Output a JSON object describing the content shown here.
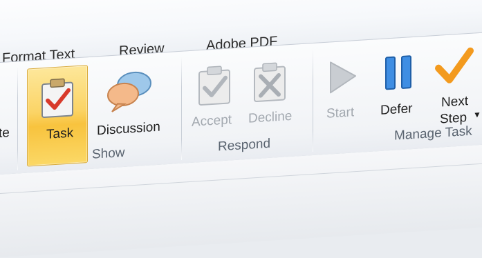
{
  "tabs": [
    "Format Text",
    "Review",
    "Adobe PDF"
  ],
  "left_partial_label": "te",
  "show_group": {
    "label": "Show",
    "task_label": "Task",
    "discussion_label": "Discussion"
  },
  "respond_group": {
    "label": "Respond",
    "accept_label": "Accept",
    "decline_label": "Decline"
  },
  "manage_group": {
    "label": "Manage Task",
    "start_label": "Start",
    "defer_label": "Defer",
    "next_step_line1": "Next",
    "next_step_line2": "Step"
  },
  "icons": {
    "task": "clipboard-check-icon",
    "discussion": "speech-bubbles-icon",
    "accept": "clipboard-check-icon",
    "decline": "clipboard-x-icon",
    "start": "play-icon",
    "defer": "pause-icon",
    "next_step": "checkmark-icon"
  },
  "colors": {
    "selected_bg": "#fbd466",
    "check_red": "#d83a2a",
    "pause_blue": "#2f7fd8",
    "check_orange": "#f39a1e",
    "disabled": "#a3a9b0"
  }
}
